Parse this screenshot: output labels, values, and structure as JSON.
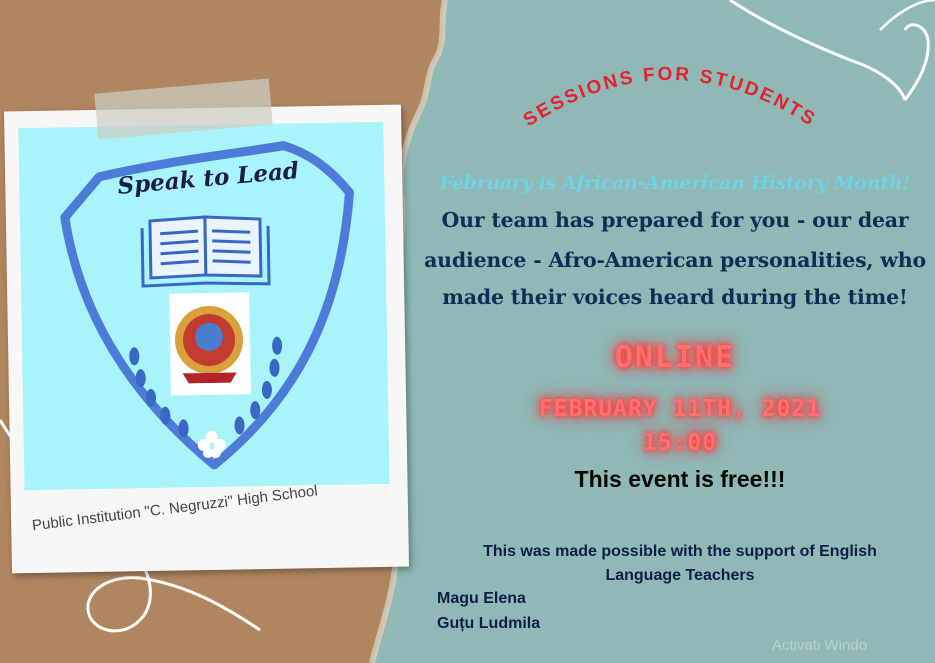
{
  "header": {
    "title": "SESSIONS FOR STUDENTS"
  },
  "intro": {
    "highlight": "February is African-American History Month!",
    "lines": [
      "Our team has prepared for you - our dear",
      "audience - Afro-American personalities, who",
      "made their voices heard during the time!"
    ]
  },
  "event": {
    "mode": "ONLINE",
    "date": "FEBRUARY 11TH, 2021",
    "time": "15:00",
    "price_note": "This event is free!!!"
  },
  "support": {
    "line1": "This was made possible with the support of English",
    "line2": "Language Teachers"
  },
  "teachers": [
    "Magu Elena",
    "Guțu Ludmila"
  ],
  "polaroid": {
    "logo_text": "Speak to Lead",
    "caption": "Public Institution \"C. Negruzzi\" High School"
  },
  "watermark": "Activati Windo",
  "colors": {
    "background_teal": "#8fb8b6",
    "cardboard": "#b08660",
    "title_red": "#e3232c",
    "highlight_cyan": "#6fd3e6",
    "body_navy": "#122d55",
    "neon_red": "#ff6f6f",
    "shield_blue": "#4f7bd8"
  }
}
